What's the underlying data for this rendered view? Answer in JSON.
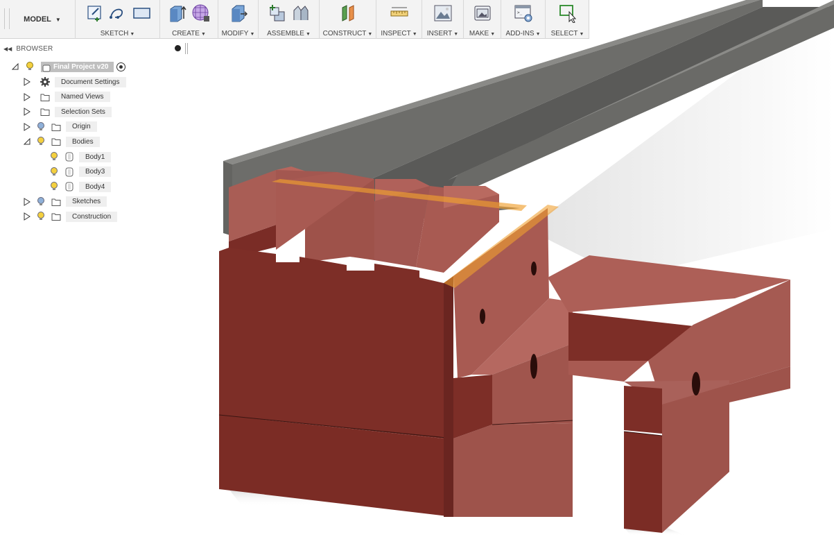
{
  "toolbar": {
    "workspace": "MODEL",
    "groups": [
      {
        "label": "SKETCH",
        "icons": [
          "sketch-create-icon",
          "arc-icon",
          "rectangle-icon"
        ]
      },
      {
        "label": "CREATE",
        "icons": [
          "extrude-icon",
          "form-icon"
        ]
      },
      {
        "label": "MODIFY",
        "icons": [
          "press-pull-icon"
        ]
      },
      {
        "label": "ASSEMBLE",
        "icons": [
          "new-component-icon",
          "joint-icon"
        ]
      },
      {
        "label": "CONSTRUCT",
        "icons": [
          "offset-plane-icon"
        ]
      },
      {
        "label": "INSPECT",
        "icons": [
          "measure-icon"
        ]
      },
      {
        "label": "INSERT",
        "icons": [
          "insert-image-icon"
        ]
      },
      {
        "label": "MAKE",
        "icons": [
          "print-3d-icon"
        ]
      },
      {
        "label": "ADD-INS",
        "icons": [
          "scripts-icon"
        ]
      },
      {
        "label": "SELECT",
        "icons": [
          "select-cursor-icon"
        ]
      }
    ]
  },
  "browser": {
    "title": "BROWSER",
    "root": "Final Project v20",
    "items": [
      {
        "label": "Document Settings",
        "icon": "gear-icon",
        "bulb": null
      },
      {
        "label": "Named Views",
        "icon": "folder-icon",
        "bulb": null
      },
      {
        "label": "Selection Sets",
        "icon": "folder-icon",
        "bulb": null
      },
      {
        "label": "Origin",
        "icon": "folder-icon",
        "bulb": "blue"
      },
      {
        "label": "Bodies",
        "icon": "folder-icon",
        "bulb": "yellow"
      },
      {
        "label": "Body1",
        "icon": "body-icon",
        "bulb": "yellow"
      },
      {
        "label": "Body3",
        "icon": "body-icon",
        "bulb": "yellow"
      },
      {
        "label": "Body4",
        "icon": "body-icon",
        "bulb": "yellow"
      },
      {
        "label": "Sketches",
        "icon": "folder-icon",
        "bulb": "blue"
      },
      {
        "label": "Construction",
        "icon": "folder-icon",
        "bulb": "yellow"
      }
    ]
  },
  "colors": {
    "body": "#a85a52",
    "body_dark": "#7d2e27",
    "channel": "#6f6f6c",
    "highlight": "#f0a030",
    "bulb_on": "#f4d03f",
    "bulb_off": "#8fb0d8"
  }
}
